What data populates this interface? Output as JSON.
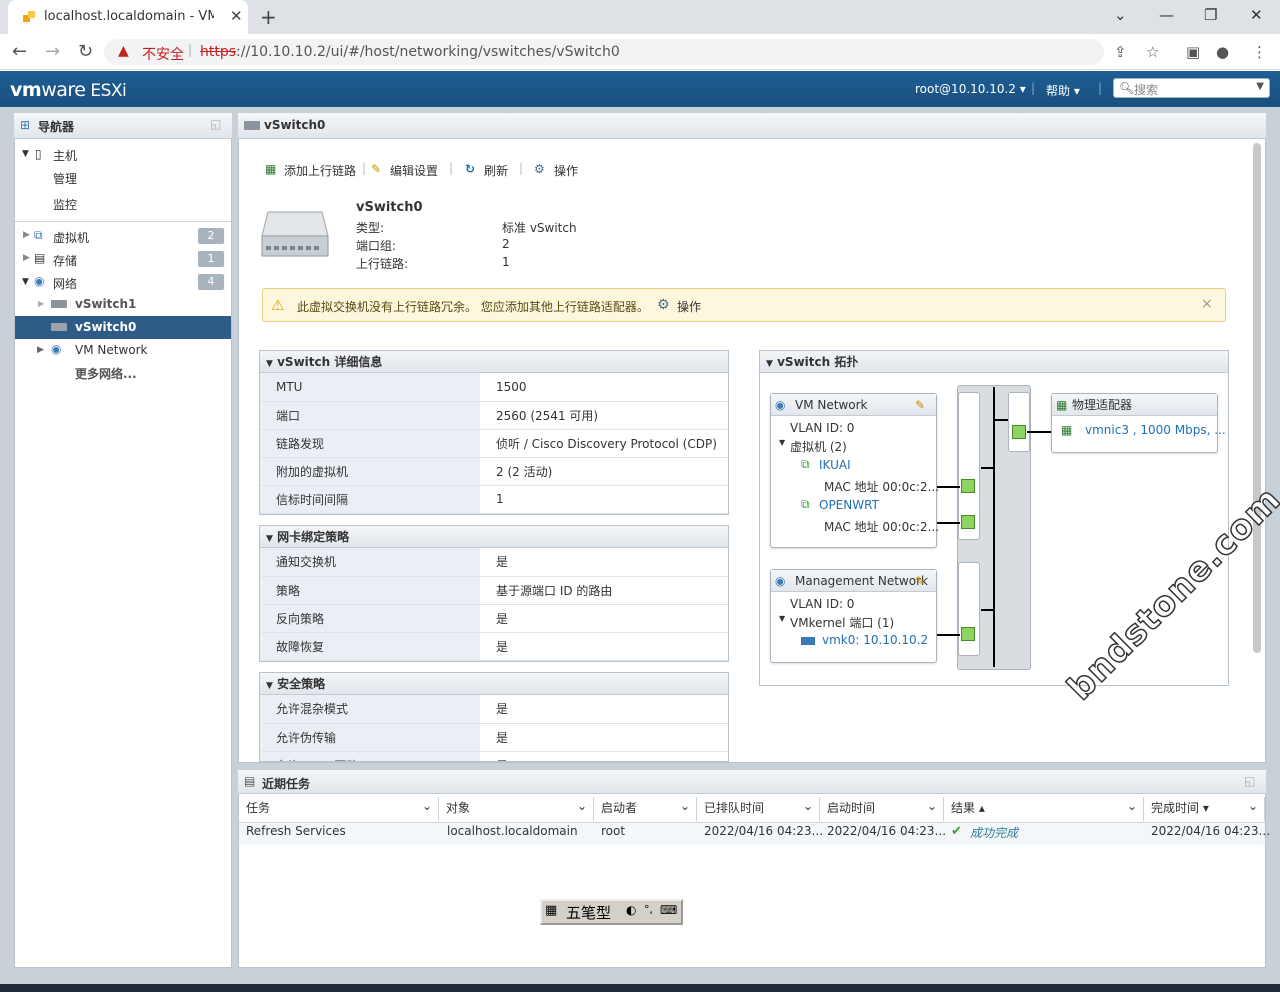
{
  "browser": {
    "tab_title": "localhost.localdomain - VMware ESXi",
    "new_tab": "+",
    "url_insecure": "不安全",
    "url_scheme": "https",
    "url_rest": "://10.10.10.2/ui/#/host/networking/vswitches/vSwitch0"
  },
  "header": {
    "brand_vm": "vm",
    "brand_ware": "ware",
    "brand_esxi": " ESXi",
    "user": "root@10.10.10.2 ▾",
    "help": "帮助 ▾",
    "search_placeholder": "搜索"
  },
  "navigator": {
    "title": "导航器",
    "host": "主机",
    "manage": "管理",
    "monitor": "监控",
    "vms": "虚拟机",
    "vms_count": "2",
    "storage": "存储",
    "storage_count": "1",
    "network": "网络",
    "network_count": "4",
    "vswitch1": "vSwitch1",
    "vswitch0": "vSwitch0",
    "vm_network": "VM Network",
    "more_networks": "更多网络..."
  },
  "content": {
    "title": "vSwitch0",
    "toolbar": {
      "add_uplink": "添加上行链路",
      "edit": "编辑设置",
      "refresh": "刷新",
      "actions": "操作"
    },
    "summary": {
      "name": "vSwitch0",
      "type_k": "类型:",
      "type_v": "标准 vSwitch",
      "pg_k": "端口组:",
      "pg_v": "2",
      "up_k": "上行链路:",
      "up_v": "1"
    },
    "alert": {
      "text": "此虚拟交换机没有上行链路冗余。 您应添加其他上行链路适配器。",
      "actions": "操作",
      "close": "×"
    },
    "details": {
      "title": "vSwitch 详细信息",
      "rows": [
        [
          "MTU",
          "1500"
        ],
        [
          "端口",
          "2560 (2541 可用)"
        ],
        [
          "链路发现",
          "侦听 / Cisco Discovery Protocol (CDP)"
        ],
        [
          "附加的虚拟机",
          "2 (2 活动)"
        ],
        [
          "信标时间间隔",
          "1"
        ]
      ]
    },
    "teaming": {
      "title": "网卡绑定策略",
      "rows": [
        [
          "通知交换机",
          "是"
        ],
        [
          "策略",
          "基于源端口 ID 的路由"
        ],
        [
          "反向策略",
          "是"
        ],
        [
          "故障恢复",
          "是"
        ]
      ]
    },
    "security": {
      "title": "安全策略",
      "rows": [
        [
          "允许混杂模式",
          "是"
        ],
        [
          "允许伪传输",
          "是"
        ],
        [
          "允许 MAC 更改",
          "是"
        ]
      ]
    },
    "topology": {
      "title": "vSwitch 拓扑",
      "vmnet": "VM Network",
      "vlan": "VLAN ID: 0",
      "vms": "虚拟机 (2)",
      "vm1": "IKUAI",
      "mac1": "MAC 地址 00:0c:2...",
      "vm2": "OPENWRT",
      "mac2": "MAC 地址 00:0c:2...",
      "mgmt": "Management Network",
      "mvlan": "VLAN ID: 0",
      "vmk": "VMkernel 端口 (1)",
      "vmk0": "vmk0: 10.10.10.2",
      "phys": "物理适配器",
      "nic": "vmnic3 , 1000 Mbps, ..."
    }
  },
  "tasks": {
    "title": "近期任务",
    "cols": [
      "任务",
      "对象",
      "启动者",
      "已排队时间",
      "启动时间",
      "结果 ▴",
      "完成时间 ▾"
    ],
    "row": [
      "Refresh Services",
      "localhost.localdomain",
      "root",
      "2022/04/16 04:23...",
      "2022/04/16 04:23...",
      "成功完成",
      "2022/04/16 04:23..."
    ]
  },
  "ime": {
    "mode": "五笔型"
  },
  "watermark": "bndstone.com",
  "colors": {
    "header": "#1d5f95",
    "selected": "#2f5b87",
    "accent_link": "#1f6fb5",
    "alert_bg": "#fdf7dd",
    "success": "#3aa13a"
  }
}
